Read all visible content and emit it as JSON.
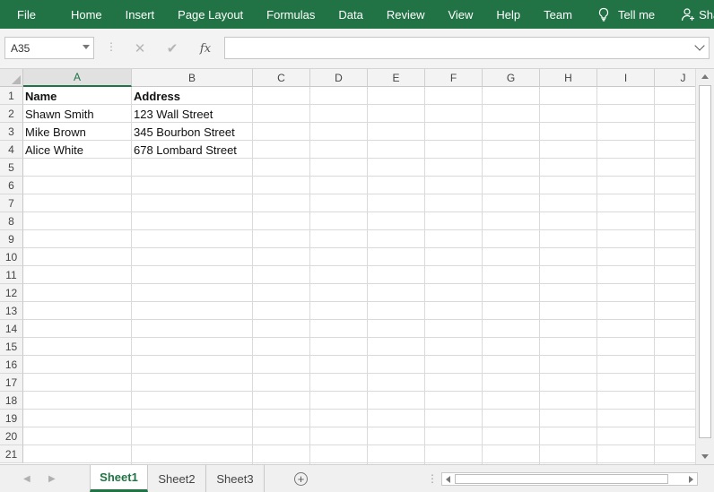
{
  "menubar": {
    "tabs": [
      "File",
      "Home",
      "Insert",
      "Page Layout",
      "Formulas",
      "Data",
      "Review",
      "View",
      "Help",
      "Team"
    ],
    "tell_me": "Tell me",
    "share": "Share"
  },
  "formula_bar": {
    "name_box": "A35",
    "formula": ""
  },
  "columns": [
    "A",
    "B",
    "C",
    "D",
    "E",
    "F",
    "G",
    "H",
    "I",
    "J"
  ],
  "rows": [
    "1",
    "2",
    "3",
    "4",
    "5",
    "6",
    "7",
    "8",
    "9",
    "10",
    "11",
    "12",
    "13",
    "14",
    "15",
    "16",
    "17",
    "18",
    "19",
    "20",
    "21"
  ],
  "cells": {
    "A1": "Name",
    "B1": "Address",
    "A2": "Shawn Smith",
    "B2": "123 Wall Street",
    "A3": "Mike Brown",
    "B3": "345 Bourbon Street",
    "A4": "Alice White",
    "B4": "678 Lombard Street"
  },
  "sheets": [
    "Sheet1",
    "Sheet2",
    "Sheet3"
  ],
  "active_sheet": "Sheet1",
  "colors": {
    "accent": "#217346"
  }
}
